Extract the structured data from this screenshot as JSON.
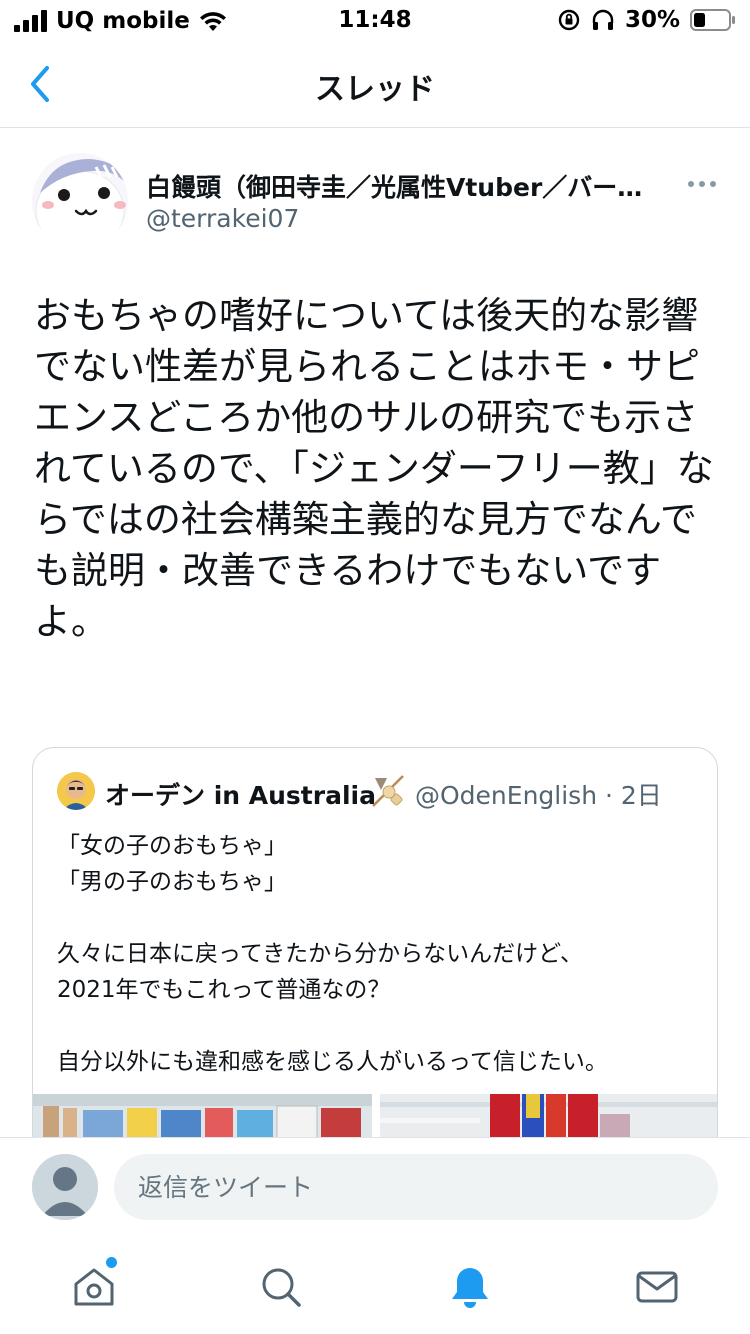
{
  "status_bar": {
    "carrier": "UQ mobile",
    "time": "11:48",
    "battery": "30%"
  },
  "nav": {
    "title": "スレッド"
  },
  "tweet": {
    "author_name": "白饅頭（御田寺圭／光属性Vtuber／バー…",
    "author_handle": "@terrakei07",
    "text": "おもちゃの嗜好については後天的な影響でない性差が見られることはホモ・サピエンスどころか他のサルの研究でも示されているので、「ジェンダーフリー教」ならではの社会構築主義的な見方でなんでも説明・改善できるわけでもないですよ。"
  },
  "quote": {
    "author_name": "オーデン in Australia",
    "author_handle": "@OdenEnglish · 2日",
    "text": "「女の子のおもちゃ」\n「男の子のおもちゃ」\n\n久々に日本に戻ってきたから分からないんだけど、\n2021年でもこれって普通なの？\n\n自分以外にも違和感を感じる人がいるって信じたい。"
  },
  "reply": {
    "placeholder": "返信をツイート"
  },
  "colors": {
    "accent": "#1d9bf0",
    "text": "#0f1419",
    "muted": "#536471",
    "border": "#cfd9de"
  },
  "icons": [
    "back-chevron-icon",
    "more-dots-icon",
    "home-icon",
    "search-icon",
    "notifications-icon",
    "messages-icon"
  ]
}
